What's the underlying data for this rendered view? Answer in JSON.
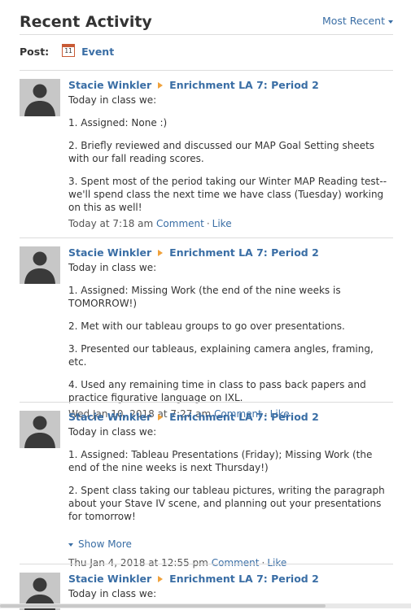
{
  "header": {
    "title": "Recent Activity",
    "sort_label": "Most Recent"
  },
  "post_bar": {
    "label": "Post:",
    "calendar_day": "11",
    "event_label": "Event"
  },
  "items": [
    {
      "author": "Stacie Winkler",
      "group": "Enrichment LA 7: Period 2",
      "intro": "Today in class we:",
      "paragraphs": [
        "1. Assigned: None :)",
        "2. Briefly reviewed and discussed our MAP Goal Setting sheets with our fall reading scores.",
        "3. Spent most of the period taking our Winter MAP Reading test--we'll spend class the next time we have class (Tuesday) working on this as well!"
      ],
      "timestamp": "Today at 7:18 am",
      "comment": "Comment",
      "like": "Like"
    },
    {
      "author": "Stacie Winkler",
      "group": "Enrichment LA 7: Period 2",
      "intro": "Today in class we:",
      "paragraphs": [
        "1. Assigned: Missing Work (the end of the nine weeks is TOMORROW!)",
        "2. Met with our tableau groups to go over presentations.",
        "3. Presented our tableaus, explaining camera angles, framing, etc.",
        "4. Used any remaining time in class to pass back papers and practice figurative language on IXL."
      ],
      "timestamp": "Wed Jan 10, 2018 at 7:27 am",
      "comment": "Comment",
      "like": "Like"
    },
    {
      "author": "Stacie Winkler",
      "group": "Enrichment LA 7: Period 2",
      "intro": "Today in class we:",
      "paragraphs": [
        "1. Assigned: Tableau Presentations (Friday); Missing Work (the end of the nine weeks is next Thursday!)",
        "2. Spent class taking our tableau pictures, writing the paragraph about your Stave IV scene, and planning out your presentations for tomorrow!"
      ],
      "show_more": "Show More",
      "timestamp": "Thu Jan 4, 2018 at 12:55 pm",
      "comment": "Comment",
      "like": "Like"
    },
    {
      "author": "Stacie Winkler",
      "group": "Enrichment LA 7: Period 2",
      "intro": "Today in class we:"
    }
  ]
}
